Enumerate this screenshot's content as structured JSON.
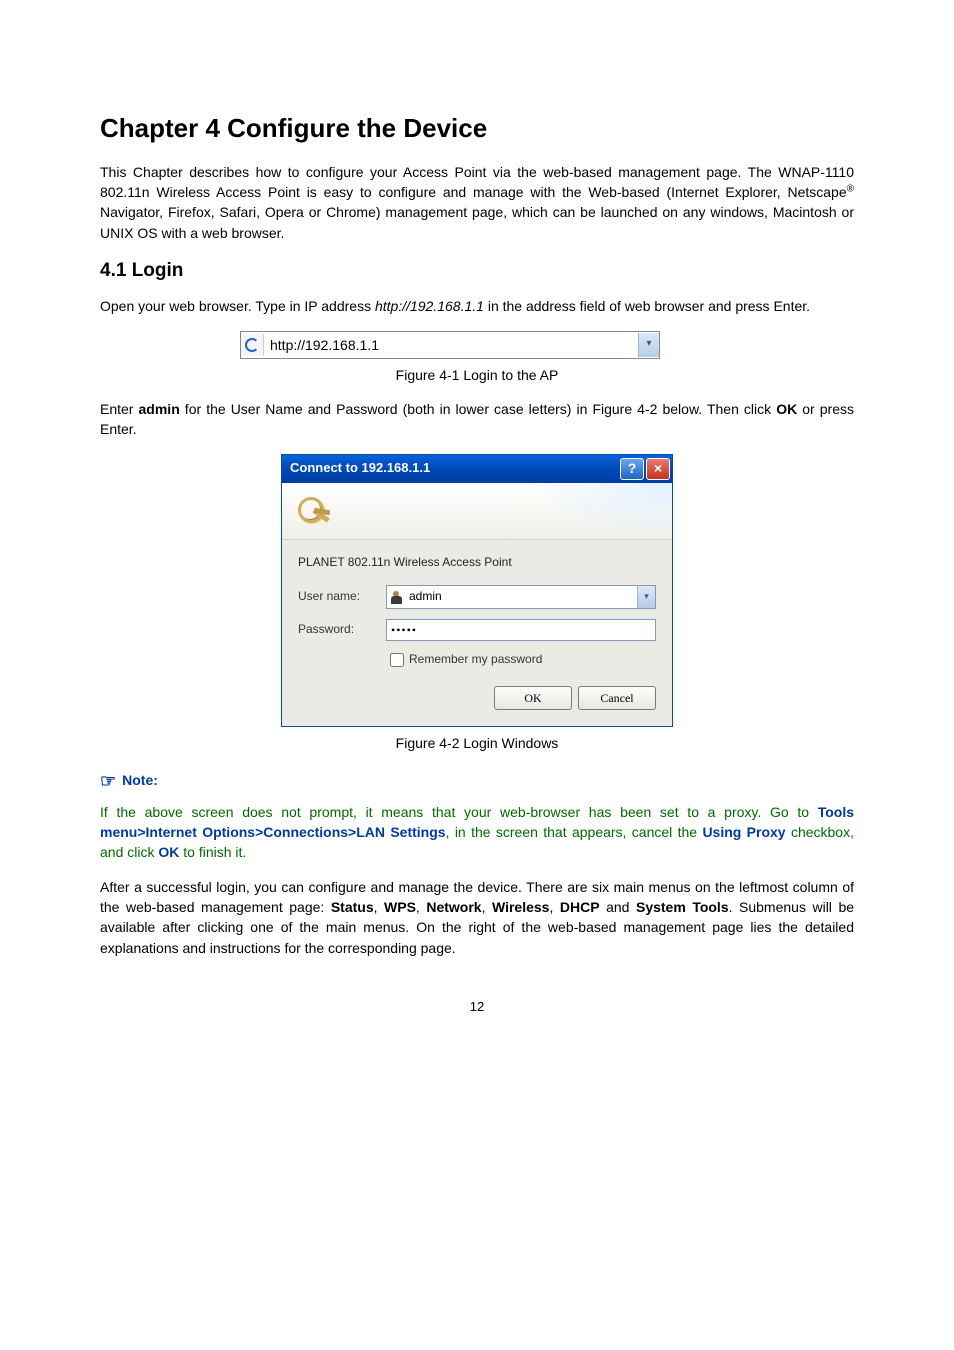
{
  "chapter": {
    "title": "Chapter 4   Configure the Device",
    "intro_1": "This Chapter describes how to configure your Access Point via the web-based management page. The WNAP-1110 802.11n Wireless Access Point is easy to configure and manage with the Web-based (Internet Explorer, Netscape",
    "intro_sup": "®",
    "intro_2": " Navigator, Firefox, Safari, Opera or Chrome) management page, which can be launched on any windows, Macintosh or UNIX OS with a web browser."
  },
  "sec41": {
    "title": "4.1   Login",
    "p1_a": "Open your web browser. Type in IP address ",
    "p1_url": "http://192.168.1.1",
    "p1_b": " in the address field of web browser and press Enter."
  },
  "addressbar": {
    "url": "http://192.168.1.1"
  },
  "captions": {
    "fig41": "Figure 4-1 Login to the AP",
    "fig42": "Figure 4-2 Login Windows"
  },
  "enter_text": {
    "a": "Enter ",
    "admin": "admin",
    "b": " for the User Name and Password (both in lower case letters) in Figure 4-2 below. Then click ",
    "ok": "OK",
    "c": " or press Enter."
  },
  "dialog": {
    "title": "Connect to 192.168.1.1",
    "subtitle": "PLANET 802.11n Wireless Access Point",
    "username_label": "User name:",
    "password_label": "Password:",
    "username_value": "admin",
    "password_value": "•••••",
    "remember_label": "Remember my password",
    "ok_label": "OK",
    "cancel_label": "Cancel",
    "help_label": "?",
    "close_label": "×"
  },
  "note": {
    "head_icon": "☞",
    "head_text": "Note:",
    "body_a": "If the above screen does not prompt, it means that your web-browser has been set to a proxy. Go to ",
    "path": "Tools menu>Internet Options>Connections>LAN Settings",
    "body_b": ", in the screen that appears, cancel the ",
    "using_proxy": "Using Proxy",
    "body_c": " checkbox, and click ",
    "ok": "OK",
    "body_d": " to finish it."
  },
  "after_login": {
    "a": "After a successful login, you can configure and manage the device. There are six main menus on the leftmost column of the web-based management page: ",
    "m1": "Status",
    "sep1": ", ",
    "m2": "WPS",
    "sep2": ", ",
    "m3": "Network",
    "sep3": ", ",
    "m4": "Wireless",
    "sep4": ", ",
    "m5": "DHCP",
    "sep5": " and ",
    "m6": "System Tools",
    "b": ". Submenus will be available after clicking one of the main menus. On the right of the web-based management page lies the detailed explanations and instructions for the corresponding page."
  },
  "page_number": "12"
}
